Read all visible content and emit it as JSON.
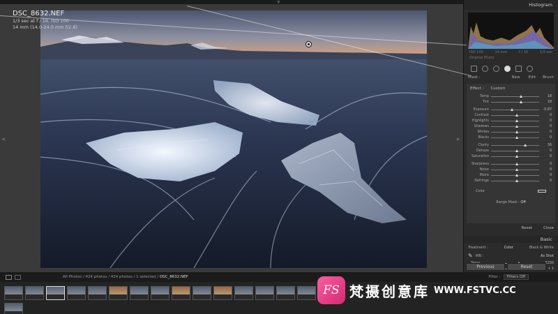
{
  "image_info": {
    "filename": "DSC_8632.NEF",
    "exposure": "1/3 sec at f / 16, ISO 100",
    "lens": "14 mm (14.0-24.0 mm f/2.8)"
  },
  "panel": {
    "histogram_label": "Histogram",
    "histogram_meta": [
      "ISO 100",
      "14 mm",
      "f / 16",
      "1/3 sec"
    ],
    "original_photo": "Original Photo",
    "mask_label": "Mask :",
    "mask_new": "New",
    "mask_edit": "Edit",
    "mask_brush": "Brush",
    "effect_label": "Effect :",
    "effect_custom": "Custom",
    "sliders": [
      {
        "label": "Temp",
        "value": "18",
        "pos": 0.6
      },
      {
        "label": "Tint",
        "value": "18",
        "pos": 0.6
      },
      {
        "label": "Exposure",
        "value": "-0.87",
        "pos": 0.4
      },
      {
        "label": "Contrast",
        "value": "0",
        "pos": 0.5
      },
      {
        "label": "Highlights",
        "value": "0",
        "pos": 0.5
      },
      {
        "label": "Shadows",
        "value": "0",
        "pos": 0.5
      },
      {
        "label": "Whites",
        "value": "0",
        "pos": 0.5
      },
      {
        "label": "Blacks",
        "value": "0",
        "pos": 0.5
      },
      {
        "label": "Clarity",
        "value": "36",
        "pos": 0.68
      },
      {
        "label": "Dehaze",
        "value": "0",
        "pos": 0.5
      },
      {
        "label": "Saturation",
        "value": "0",
        "pos": 0.5
      },
      {
        "label": "Sharpness",
        "value": "0",
        "pos": 0.5
      },
      {
        "label": "Noise",
        "value": "0",
        "pos": 0.5
      },
      {
        "label": "Moiré",
        "value": "0",
        "pos": 0.5
      },
      {
        "label": "Defringe",
        "value": "0",
        "pos": 0.5
      }
    ],
    "color_label": "Color",
    "range_mask_label": "Range Mask :",
    "range_mask_value": "Off",
    "reset_label": "Reset",
    "close_label": "Close",
    "basic_label": "Basic",
    "treatment_label": "Treatment :",
    "treatment_color": "Color",
    "treatment_bw": "Black & White",
    "wb_label": "WB :",
    "wb_value": "As Shot",
    "temp_label": "Temp",
    "temp_value": "5250",
    "tint_label": "Tint",
    "tint_value": "+ 1",
    "previous_btn": "Previous",
    "reset_btn": "Reset"
  },
  "filmstrip": {
    "path_prefix": "All Photos / 424 photos / 424 photos / 1 selected /",
    "current_file": "DSC_8632.NEF",
    "filter_label": "Filter :",
    "filter_value": "Filters Off"
  },
  "watermark": {
    "logo": "FS",
    "chinese": "梵摄创意库",
    "url": "WWW.FSTVC.CC"
  },
  "colors": {
    "panel_bg": "#2b2b2b",
    "accent": "#d62874"
  }
}
